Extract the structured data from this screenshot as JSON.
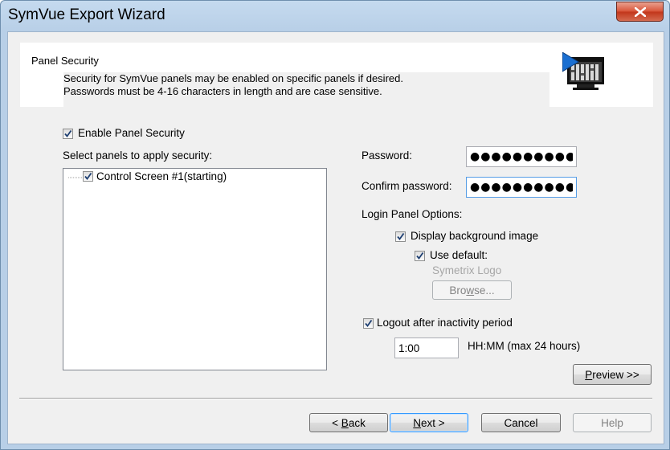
{
  "window": {
    "title": "SymVue Export Wizard"
  },
  "header": {
    "title": "Panel Security",
    "line1": "Security for SymVue panels may be enabled on specific panels if desired.",
    "line2": "Passwords must be 4-16 characters in length and are case sensitive."
  },
  "enable_security": {
    "label": "Enable Panel Security",
    "checked": true
  },
  "panels": {
    "label": "Select panels to apply security:",
    "items": [
      {
        "label": "Control Screen #1(starting)",
        "checked": true
      }
    ]
  },
  "password": {
    "label": "Password:",
    "value": "●●●●●●●●●●"
  },
  "confirm_password": {
    "label": "Confirm password:",
    "value": "●●●●●●●●●●"
  },
  "login_options": {
    "label": "Login Panel Options:",
    "display_bg": {
      "label": "Display background image",
      "checked": true
    },
    "use_default": {
      "label": "Use default:",
      "checked": true
    },
    "default_name": "Symetrix Logo",
    "browse": {
      "pre": "Bro",
      "key": "w",
      "post": "se..."
    }
  },
  "logout": {
    "label": "Logout after inactivity period",
    "checked": true,
    "value": "1:00",
    "unit": "HH:MM (max 24 hours)"
  },
  "preview": {
    "key": "P",
    "rest": "review >>"
  },
  "buttons": {
    "back": {
      "pre": "< ",
      "key": "B",
      "post": "ack"
    },
    "next": {
      "key": "N",
      "post": "ext >"
    },
    "cancel": "Cancel",
    "help": "Help"
  }
}
